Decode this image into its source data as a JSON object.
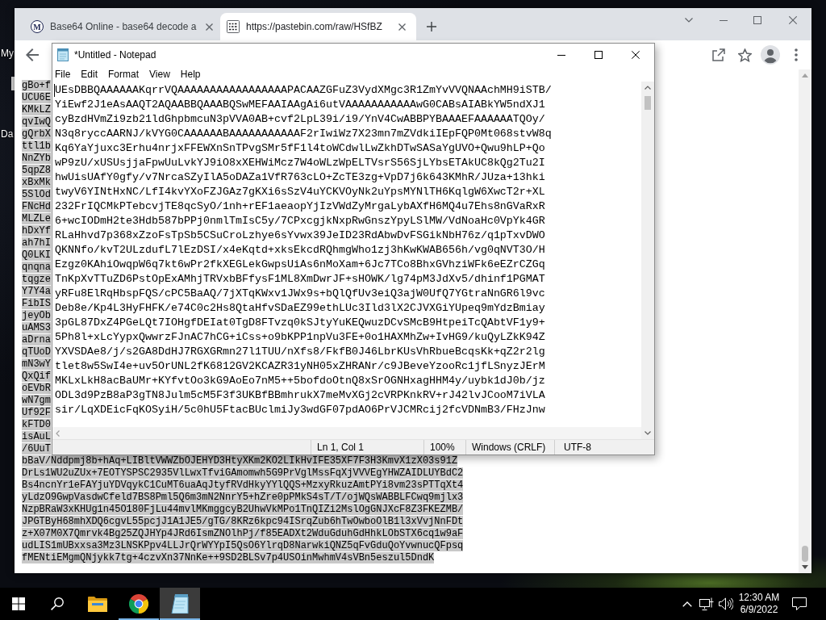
{
  "desktop": {
    "icon_labels": [
      "My",
      "Da"
    ]
  },
  "browser": {
    "tabs": [
      {
        "favicon": {
          "kind": "letter",
          "text": "M"
        },
        "title": "Base64 Online - base64 decode a",
        "selected": false
      },
      {
        "favicon": {
          "kind": "file"
        },
        "title": "https://pastebin.com/raw/HSfBZ",
        "selected": true
      }
    ],
    "page": {
      "selected": true,
      "lines": [
        "gBo+f",
        "UCU6E",
        "KMkLZ",
        "qvIwQ",
        "gQrbX",
        "ttl1b",
        "NnZYb",
        "5qpZ8",
        "xBxMk",
        "5SlOd",
        "FNcHd",
        "MLZLe",
        "hDxYf",
        "ah7hI",
        "Q0LKI",
        "qnqna",
        "tqgze",
        "Y7Y4a",
        "FibIS",
        "jeyOb",
        "uAMS3",
        "aDrna",
        "qTUoD",
        "mN3wY",
        "QxQif",
        "oEVbR",
        "wN7gm",
        "Uf92F",
        "kFTD0",
        "isAuL",
        "/6UuT",
        "bBaV/Nddpmj8b+hAq+LIBltVWWZbOJEHYD3HtyXKm2KO2LIkHvIFE35XF7F3H3KmvX1zX03s91Z",
        "DrLs1WU2uZUx+7EOTYSPSC2935VlLwxTfviGAmomwh5G9PrVglMssFqXjVVVEgYHWZAIDLUYBdC2",
        "Bs4ncnYr1eFAYjuYDVqykC1CuMT6uaAqJtyfRVdHkyYYlQQS+MzxyRkuzAmtPYi8vm23sPTTqXt4",
        "yLdzO9GwpVasdwCfeld7BS8Pml5Q6m3mN2NnrY5+hZre0pPMkS4sT/T/ojWQsWABBLFCwq9mjlx3",
        "NzpBRaW3xKHUg1n45O180FjLu44mvlMKmggcyB2UhwVkMPo1TnQIZi2MslOgGNJXcF8Z3FKEZMB/",
        "JPGTByH68mhXDQ6cgvL55pcjJ1A1JE5/gTG/8KRz6kpc94ISrqZub6hTwOwboOlB1l3xVvjNnFDt",
        "z+X07M0X7Qmrvk4Bg25ZQJHYp4JRd6IsmZNOlhPj/f85EADXt2WduGduhGdHhkLObSTX6cq1w9aF",
        "udLIS1mUBxxsa3Mz3LNSKPpv4LLJrQrWYYpI5QsO6YlrqD8NarwkiQNZ5qFvGduQoYvwnucQFpsq",
        "fMENtiEMgmQNjykk7tg+4czvXn37NnKe++9SD2BLSv7p4USOinMwhmV4sVBn5eszul5DndK"
      ]
    }
  },
  "notepad": {
    "title": "*Untitled - Notepad",
    "menu": [
      "File",
      "Edit",
      "Format",
      "View",
      "Help"
    ],
    "lines": [
      "UEsDBBQAAAAAAKqrrVQAAAAAAAAAAAAAAAAAPACAAZGFuZ3VydXMgc3R1ZmYvVVQNAAchMH9iSTB/",
      "YiEwf2J1eAsAAQT2AQAABBQAAABQSwMEFAAIAAgAi6utVAAAAAAAAAAAwG0CABsAIABkYW5ndXJ1",
      "cyBzdHVmZi9zb21ldGhpbmcuN3pVVA0AB+cvf2LpL39i/i9/YnV4CwABBPYBAAAEFAAAAAATQOy/",
      "N3q8ryccAARNJ/kVYG0CAAAAAABAAAAAAAAAAAF2rIwiWz7X23mn7mZVdkiIEpFQP0Mt068stvW8q",
      "Kq6YaYjuxc3Erhu4nrjxFFEWXnSnTPvgSMr5fF1l4toWCdwlLwZkhDTwSASaYgUVO+Qwu9hLP+Qo",
      "wP9zU/xUSUsjjaFpwUuLvkYJ9iO8xXEHWiMcz7W4oWLzWpELTVsrS56SjLYbsETAkUC8kQg2Tu2I",
      "hwUisUAfY0gfy/v7NrcaSZyIlA5oDAZa1VfR763cLO+ZcTE3zg+VpD7j6k643KMhR/JUza+13hki",
      "twyV6YINtHxNC/LfI4kvYXoFZJGAz7gKXi6sSzV4uYCKVOyNk2uYpsMYNlTH6KqlgW6XwcT2r+XL",
      "232FrIQCMkPTebcvjTE8qcSyO/1nh+rEF1aeaopYjIzVWdZyMrgaLybAXfH6MQ4u7Ehs8nGVaRxR",
      "6+wcIODmH2te3Hdb587bPPj0nmlTmIsC5y/7CPxcgjkNxpRwGnszYpyLSlMW/VdNoaHc0VpYk4GR",
      "RLaHhvd7p368xZzoFsTpSb5CSuCroLzhye6sYvwx39JeID23RdAbwDvFSGikNbH76z/q1pTxvDWO",
      "QKNNfo/kvT2ULzdufL7lEzDSI/x4eKqtd+xksEkcdRQhmgWho1zj3hKwKWAB656h/vg0qNVT3O/H",
      "Ezgz0KAhiOwqpW6q7kt6wPr2fkXEGLekGwpsUiAs6nMoXam+6Jc7TCo8BhxGVhziWFk6eEZrCZGq",
      "TnKpXvTTuZD6PstOpExAMhjTRVxbBFfysF1ML8XmDwrJF+sHOWK/lg74pM3JdXv5/dhinf1PGMAT",
      "yRFu8ElRqHbspFQS/cPC5BaAQ/7jXTqKWxv1JWx9s+bQlQfUv3eiQ3ajW0UfQ7YGtraNnGR6l9vc",
      "Deb8e/Kp4L3HyFHFK/e74C0c2Hs8QtaHfvSDaEZ99ethLUc3Ild3lX2CJVXGiYUpeq9mYdzBmiay",
      "3pGL87DxZ4PGeLQt7IOHgfDEIat0TgD8FTvzq0kSJtyYuKEQwuzDCvSMcB9HtpeiTcQAbtVF1y9+",
      "5Ph8l+xLcYypxQwwrzFJnAC7hCG+iCss+o9bKPP1npVu3FE+0o1HAXMhZw+IvHG9/kuQyLZkK94Z",
      "YXVSDAe8/j/s2GA8DdHJ7RGXGRmn27l1TUU/nXfs8/FkfB0J46LbrKUsVhRbueBcqsKk+qZ2r2lg",
      "tlet8w5SwI4e+uv5OrUNL2fK6812GV2KCAZR31yNH05xZHRANr/c9JBeveYzooRc1jfLSnyzJErM",
      "MKLxLkH8acBaUMr+KYfvtOo3kG9AoEo7nM5++5bofdoOtnQ8xSrOGNHxagHHM4y/uybk1dJ0b/jz",
      "ODL3d9PzB8aP3gTN8Julm5cM5F3f3UKBfBBmhrukX7meMvXGj2cVRPKnkRV+rJ42lvJCooM7iVLA",
      "sir/LqXDEicFqKOSyiH/5c0hU5FtacBUclmiJy3wdGF07pdAO6PrVJCMRcij2fcVDNmB3/FHzJnw"
    ],
    "status": {
      "position": "Ln 1, Col 1",
      "zoom": "100%",
      "line_ending": "Windows (CRLF)",
      "encoding": "UTF-8"
    }
  },
  "taskbar": {
    "apps": [
      {
        "kind": "folder",
        "running": false,
        "active": false
      },
      {
        "kind": "browser",
        "running": true,
        "active": false
      },
      {
        "kind": "notepad",
        "running": true,
        "active": true
      }
    ],
    "time": "12:30 AM",
    "date": "6/9/2022"
  }
}
